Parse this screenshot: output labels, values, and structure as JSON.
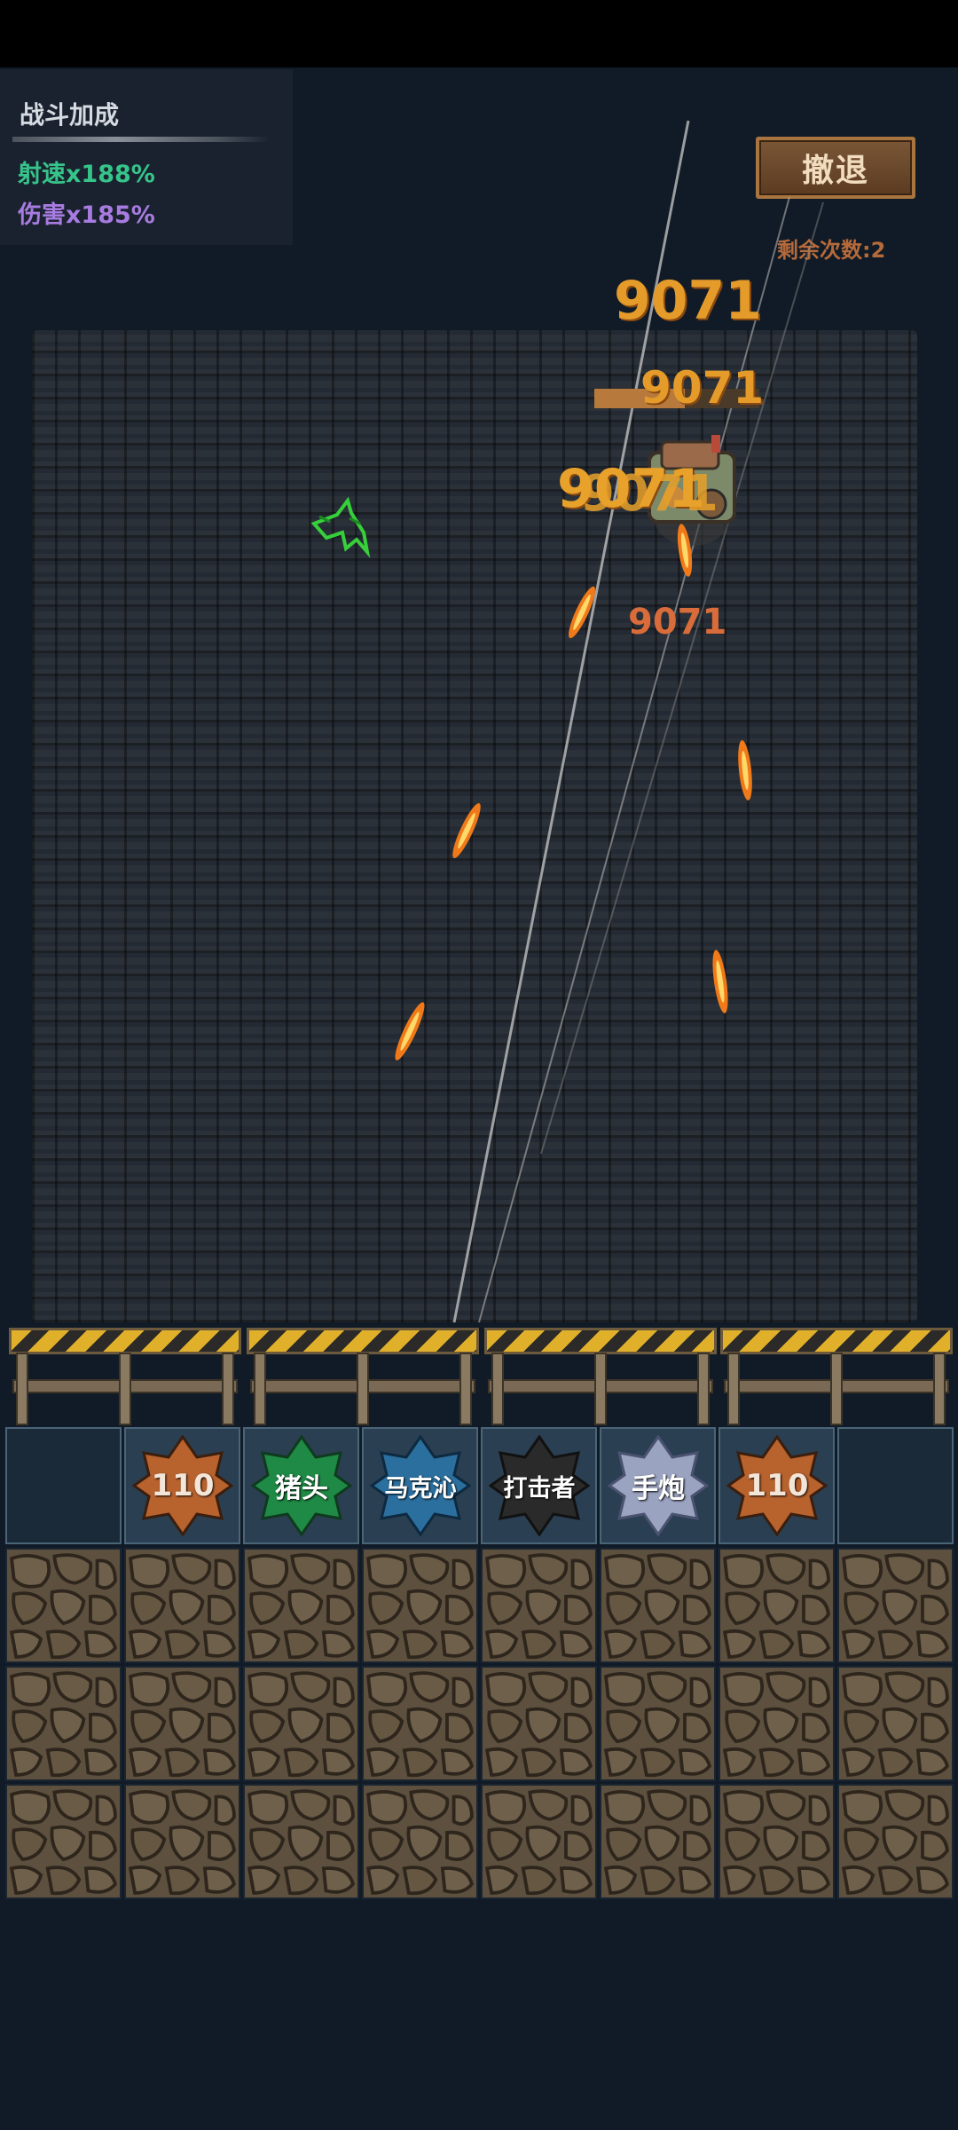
{
  "bonus": {
    "title": "战斗加成",
    "fire_rate": "射速x188%",
    "damage": "伤害x185%"
  },
  "retreat": {
    "label": "撤退",
    "remaining": "剩余次数:2"
  },
  "damage_numbers": [
    "9071",
    "9071",
    "9071",
    "9071",
    "9071"
  ],
  "enemy": {
    "health_fraction": 0.55
  },
  "weapon_slots": [
    {
      "label": "",
      "type": "empty"
    },
    {
      "label": "110",
      "type": "orange"
    },
    {
      "label": "猪头",
      "type": "green"
    },
    {
      "label": "马克沁",
      "type": "blue"
    },
    {
      "label": "打击者",
      "type": "black"
    },
    {
      "label": "手炮",
      "type": "silver"
    },
    {
      "label": "110",
      "type": "orange"
    },
    {
      "label": "",
      "type": "empty"
    }
  ],
  "colors": {
    "orange": "#b8622e",
    "green": "#1f8a45",
    "blue": "#2b6f9e",
    "black": "#2a2a2a",
    "silver": "#9aa3c0"
  },
  "stone_grid": {
    "rows": 3,
    "cols": 8
  }
}
